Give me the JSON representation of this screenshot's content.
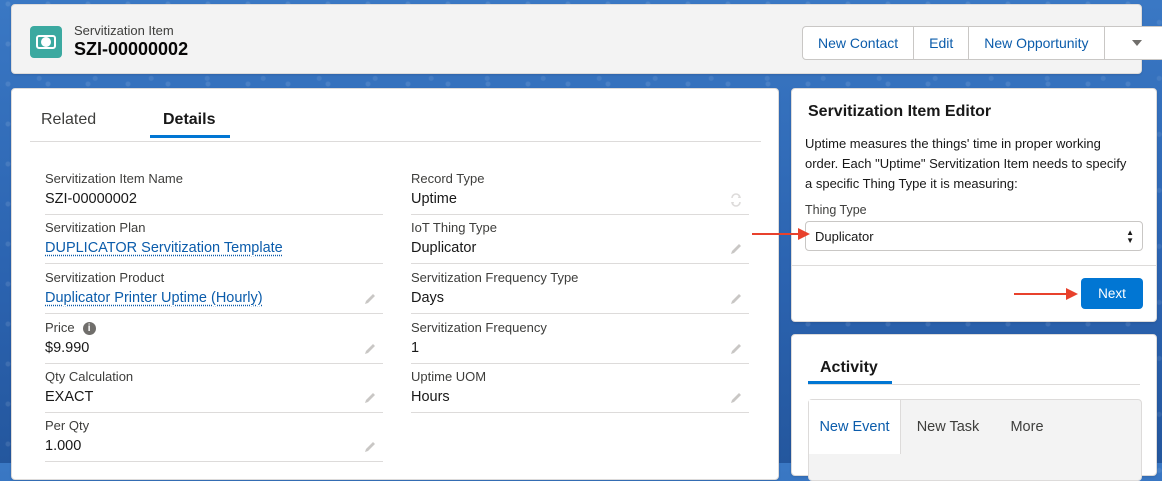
{
  "header": {
    "object_type": "Servitization Item",
    "record_name": "SZI-00000002",
    "actions": [
      "New Contact",
      "Edit",
      "New Opportunity"
    ]
  },
  "details": {
    "tabs": [
      "Related",
      "Details"
    ],
    "active_tab": "Details",
    "left_fields": [
      {
        "label": "Servitization Item Name",
        "value": "SZI-00000002"
      },
      {
        "label": "Servitization Plan",
        "value": "DUPLICATOR Servitization Template"
      },
      {
        "label": "Servitization Product",
        "value": "Duplicator Printer Uptime (Hourly)"
      },
      {
        "label": "Price",
        "value": "$9.990"
      },
      {
        "label": "Qty Calculation",
        "value": "EXACT"
      },
      {
        "label": "Per Qty",
        "value": "1.000"
      }
    ],
    "right_fields": [
      {
        "label": "Record Type",
        "value": "Uptime"
      },
      {
        "label": "IoT Thing Type",
        "value": "Duplicator"
      },
      {
        "label": "Servitization Frequency Type",
        "value": "Days"
      },
      {
        "label": "Servitization Frequency",
        "value": "1"
      },
      {
        "label": "Uptime UOM",
        "value": "Hours"
      }
    ]
  },
  "editor": {
    "title": "Servitization Item Editor",
    "description": "Uptime measures the things' time in proper working order. Each \"Uptime\" Servitization Item needs to specify a specific Thing Type it is measuring:",
    "thing_type_label": "Thing Type",
    "thing_type_value": "Duplicator",
    "next_label": "Next",
    "accent": "#0176d3"
  },
  "activity": {
    "tab": "Activity",
    "buttons": [
      "New Event",
      "New Task",
      "More"
    ]
  },
  "icons": {
    "object": "servitization-item-icon",
    "edit": "pencil-icon",
    "info": "info-icon",
    "record_type": "change-record-type-icon"
  }
}
